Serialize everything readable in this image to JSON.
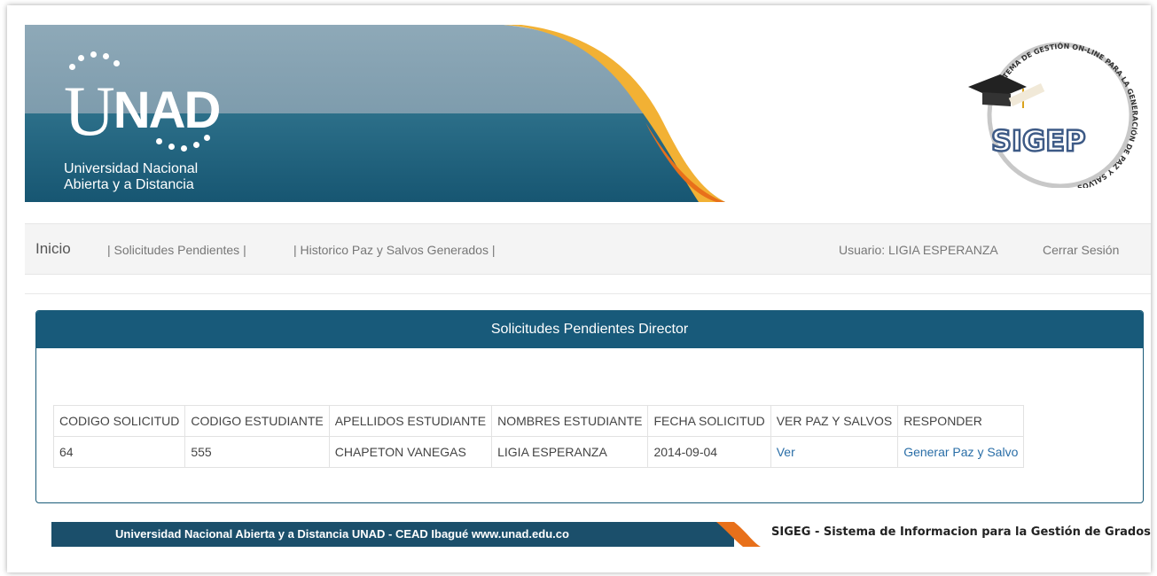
{
  "header": {
    "logo_text": "UNAD",
    "university_line1": "Universidad Nacional",
    "university_line2": "Abierta y a Distancia",
    "sigep_logo": "SIGEP",
    "sigep_ring_text": "SISTEMA DE GESTIÓN ON-LINE PARA LA GENERACIÓN DE PAZ Y SALVOS",
    "colors": {
      "teal": "#1c5f7b",
      "steel": "#8aa5b5",
      "orange": "#e8701a",
      "yellow": "#f2b134"
    }
  },
  "nav": {
    "home": "Inicio",
    "pending": "| Solicitudes Pendientes |",
    "history": "| Historico Paz y Salvos Generados |",
    "user": "Usuario: LIGIA ESPERANZA",
    "logout": "Cerrar Sesión"
  },
  "panel": {
    "title": "Solicitudes Pendientes Director",
    "columns": [
      "CODIGO SOLICITUD",
      "CODIGO ESTUDIANTE",
      "APELLIDOS ESTUDIANTE",
      "NOMBRES ESTUDIANTE",
      "FECHA SOLICITUD",
      "VER PAZ Y SALVOS",
      "RESPONDER"
    ],
    "rows": [
      {
        "codigo_solicitud": "64",
        "codigo_estudiante": "555",
        "apellidos": "CHAPETON VANEGAS",
        "nombres": "LIGIA ESPERANZA",
        "fecha": "2014-09-04",
        "ver": "Ver",
        "responder": "Generar Paz y Salvo"
      }
    ]
  },
  "footer": {
    "left": "Universidad Nacional Abierta y a Distancia UNAD - CEAD Ibagué  www.unad.edu.co",
    "right": "SIGEG - Sistema de Informacion para la Gestión de Grados"
  }
}
